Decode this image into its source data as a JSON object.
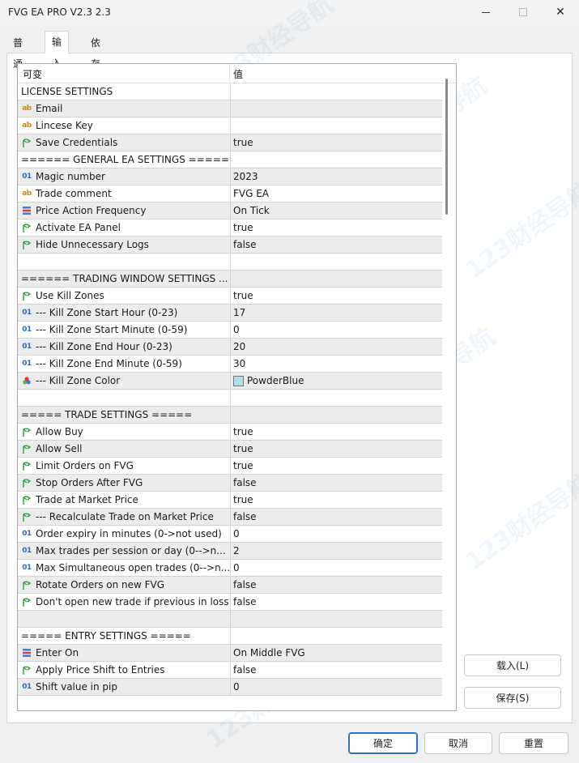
{
  "window": {
    "title": "FVG EA PRO V2.3 2.3"
  },
  "tabs": [
    {
      "label": "普通"
    },
    {
      "label": "输入"
    },
    {
      "label": "依存关系"
    }
  ],
  "grid": {
    "col_name": "可变",
    "col_value": "值",
    "rows": [
      {
        "icon": "none",
        "name": "LICENSE SETTINGS",
        "value": ""
      },
      {
        "icon": "string",
        "name": "Email",
        "value": ""
      },
      {
        "icon": "string",
        "name": "Lincese Key",
        "value": ""
      },
      {
        "icon": "bool",
        "name": "Save Credentials",
        "value": "true"
      },
      {
        "icon": "none",
        "name": "====== GENERAL EA SETTINGS =====",
        "value": ""
      },
      {
        "icon": "int",
        "name": "Magic number",
        "value": "2023"
      },
      {
        "icon": "string",
        "name": "Trade comment",
        "value": "FVG EA"
      },
      {
        "icon": "enum",
        "name": "Price Action Frequency",
        "value": "On Tick"
      },
      {
        "icon": "bool",
        "name": "Activate EA Panel",
        "value": "true"
      },
      {
        "icon": "bool",
        "name": "Hide Unnecessary Logs",
        "value": "false"
      },
      {
        "icon": "none",
        "name": "",
        "value": ""
      },
      {
        "icon": "none",
        "name": "====== TRADING WINDOW SETTINGS ...",
        "value": ""
      },
      {
        "icon": "bool",
        "name": "Use Kill Zones",
        "value": "true"
      },
      {
        "icon": "int",
        "name": "--- Kill Zone Start Hour (0-23)",
        "value": "17"
      },
      {
        "icon": "int",
        "name": "--- Kill Zone Start Minute (0-59)",
        "value": "0"
      },
      {
        "icon": "int",
        "name": "--- Kill Zone End Hour (0-23)",
        "value": "20"
      },
      {
        "icon": "int",
        "name": "--- Kill Zone End Minute (0-59)",
        "value": "30"
      },
      {
        "icon": "color",
        "name": "--- Kill Zone Color",
        "value": "PowderBlue",
        "swatch": "#b0e0e6"
      },
      {
        "icon": "none",
        "name": "",
        "value": ""
      },
      {
        "icon": "none",
        "name": "===== TRADE SETTINGS =====",
        "value": ""
      },
      {
        "icon": "bool",
        "name": "Allow Buy",
        "value": "true"
      },
      {
        "icon": "bool",
        "name": "Allow Sell",
        "value": "true"
      },
      {
        "icon": "bool",
        "name": "Limit Orders on FVG",
        "value": "true"
      },
      {
        "icon": "bool",
        "name": "Stop Orders After FVG",
        "value": "false"
      },
      {
        "icon": "bool",
        "name": "Trade at Market Price",
        "value": "true"
      },
      {
        "icon": "bool",
        "name": "--- Recalculate Trade on Market Price",
        "value": "false"
      },
      {
        "icon": "int",
        "name": "Order expiry in minutes (0->not used)",
        "value": "0"
      },
      {
        "icon": "int",
        "name": "Max trades per session or day (0-->n...",
        "value": "2"
      },
      {
        "icon": "int",
        "name": "Max Simultaneous open trades (0-->n...",
        "value": "0"
      },
      {
        "icon": "bool",
        "name": "Rotate Orders on new FVG",
        "value": "false"
      },
      {
        "icon": "bool",
        "name": "Don't open new trade if previous in loss",
        "value": "false"
      },
      {
        "icon": "none",
        "name": "",
        "value": ""
      },
      {
        "icon": "none",
        "name": "===== ENTRY SETTINGS =====",
        "value": ""
      },
      {
        "icon": "enum",
        "name": "Enter On",
        "value": "On Middle FVG"
      },
      {
        "icon": "bool",
        "name": "Apply Price Shift to Entries",
        "value": "false"
      },
      {
        "icon": "int",
        "name": "Shift value in pip",
        "value": "0"
      }
    ]
  },
  "side_buttons": {
    "load": "载入(L)",
    "save": "保存(S)"
  },
  "footer_buttons": {
    "ok": "确定",
    "cancel": "取消",
    "reset": "重置"
  },
  "watermark": "123财经导航",
  "colors": {
    "bool_icon": "#2e9b3e",
    "int_icon": "#2a6bbf",
    "string_icon": "#c48a1c",
    "accent": "#2f6fbf"
  }
}
